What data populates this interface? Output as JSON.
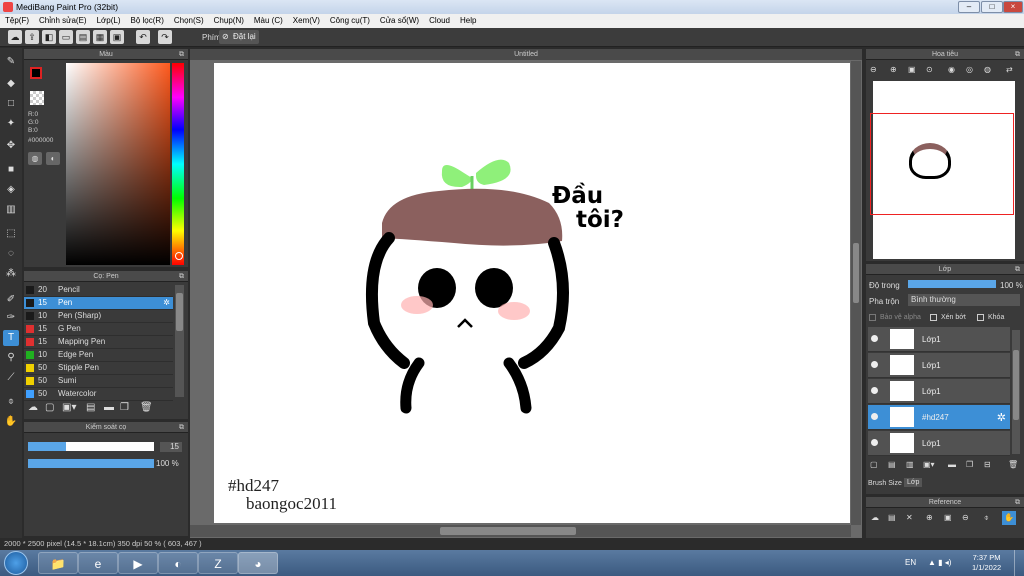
{
  "window": {
    "title": "MediBang Paint Pro (32bit)"
  },
  "menu": [
    "Tệp(F)",
    "Chỉnh sửa(E)",
    "Lớp(L)",
    "Bộ lọc(R)",
    "Chọn(S)",
    "Chụp(N)",
    "Màu (C)",
    "Xem(V)",
    "Công cụ(T)",
    "Cửa sổ(W)",
    "Cloud",
    "Help"
  ],
  "toolbar": {
    "phim_label": "Phím",
    "reset_label": "Đặt lại"
  },
  "color_panel": {
    "title": "Màu",
    "r": "R:0",
    "g": "G:0",
    "b": "B:0",
    "hex": "#000000"
  },
  "brush_panel": {
    "title": "Cọ: Pen",
    "items": [
      {
        "size": "20",
        "name": "Pencil",
        "color": "#1a1a1a"
      },
      {
        "size": "15",
        "name": "Pen",
        "color": "#1a1a1a"
      },
      {
        "size": "10",
        "name": "Pen (Sharp)",
        "color": "#1a1a1a"
      },
      {
        "size": "15",
        "name": "G Pen",
        "color": "#e03030"
      },
      {
        "size": "15",
        "name": "Mapping Pen",
        "color": "#e03030"
      },
      {
        "size": "10",
        "name": "Edge Pen",
        "color": "#20b020"
      },
      {
        "size": "50",
        "name": "Stipple Pen",
        "color": "#f0d000"
      },
      {
        "size": "50",
        "name": "Sumi",
        "color": "#f0d000"
      },
      {
        "size": "50",
        "name": "Watercolor",
        "color": "#40a0ff"
      }
    ]
  },
  "kiem_soat": {
    "title": "Kiểm soát cọ",
    "size_value": "15",
    "opacity_value": "100 %",
    "size_fraction": 0.3,
    "opacity_fraction": 1.0
  },
  "canvas": {
    "tab_title": "Untitled",
    "speech_text_1": "Đầu",
    "speech_text_2": "tôi?",
    "watermark_1": "#hd247",
    "watermark_2": "baongoc2011"
  },
  "navigator": {
    "title": "Hoa tiêu"
  },
  "layer_panel": {
    "title": "Lớp",
    "opacity_label": "Độ trong",
    "opacity_value": "100 %",
    "opacity_fraction": 1.0,
    "blend_label": "Pha trộn",
    "blend_value": "Bình thường",
    "alpha_label": "Bảo vệ alpha",
    "clip_label": "Xén bớt",
    "lock_label": "Khóa",
    "layers": [
      {
        "name": "Lớp1"
      },
      {
        "name": "Lớp1"
      },
      {
        "name": "Lớp1"
      },
      {
        "name": "#hd247"
      },
      {
        "name": "Lớp1"
      }
    ],
    "tab_brush_size": "Brush Size",
    "tab_layer": "Lớp"
  },
  "reference": {
    "title": "Reference"
  },
  "status": {
    "text": "2000 * 2500 pixel (14.5 * 18.1cm) 350 dpi 50 % ( 603, 467 )"
  },
  "taskbar": {
    "lang": "EN",
    "time": "7:37 PM",
    "date": "1/1/2022"
  }
}
